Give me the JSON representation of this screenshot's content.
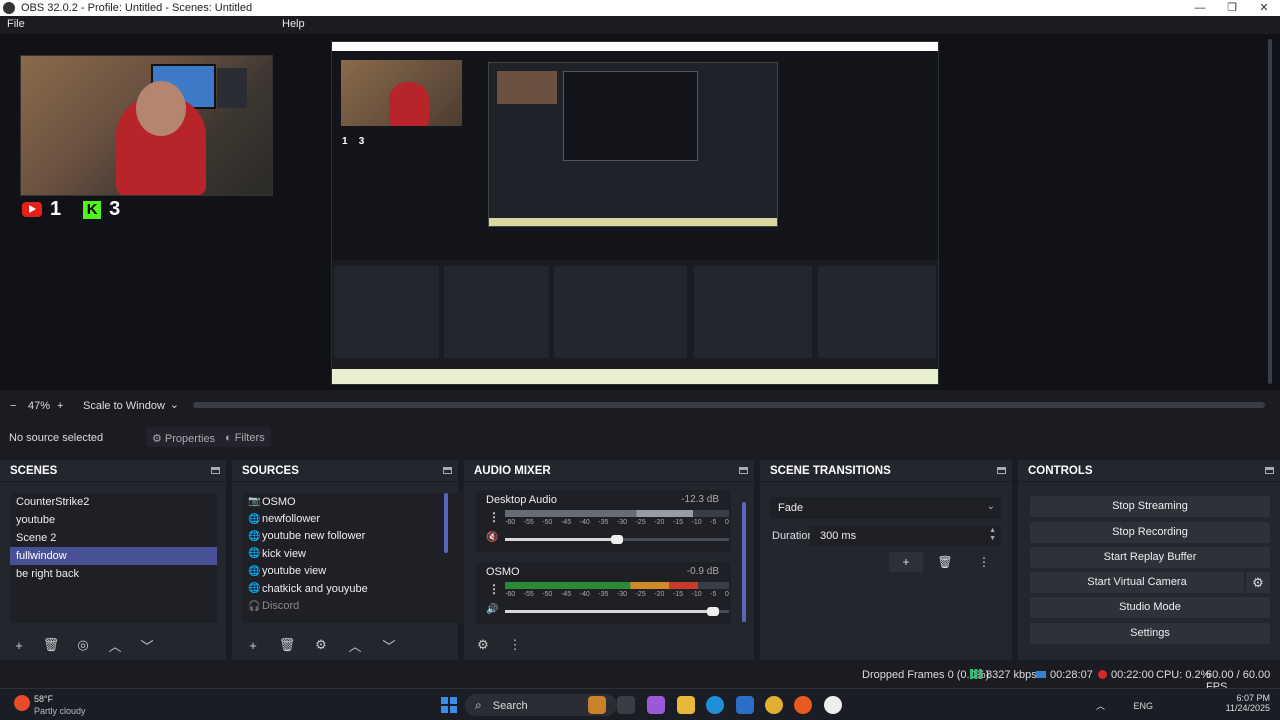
{
  "window": {
    "title": "OBS 32.0.2 - Profile: Untitled - Scenes: Untitled",
    "minimize": "—",
    "maximize": "❐",
    "close": "✕"
  },
  "menu": {
    "file": "File",
    "help": "Help"
  },
  "preview": {
    "yt_count": "1",
    "kick_count": "3",
    "kick_letter": "K"
  },
  "zoom": {
    "minus": "−",
    "level": "47%",
    "plus": "+",
    "scale_mode": "Scale to Window",
    "chevron": "⌄"
  },
  "source_bar": {
    "no_source": "No source selected",
    "properties": "Properties",
    "filters": "Filters"
  },
  "scenes": {
    "title": "SCENES",
    "items": [
      "CounterStrike2",
      "youtube",
      "Scene 2",
      "fullwindow",
      "be right back"
    ],
    "selected_index": 3
  },
  "sources": {
    "title": "SOURCES",
    "items": [
      {
        "name": "OSMO",
        "icon": "camera-icon",
        "visible": true
      },
      {
        "name": "newfollower",
        "icon": "globe-icon",
        "visible": true
      },
      {
        "name": "youtube new follower",
        "icon": "globe-icon",
        "visible": true
      },
      {
        "name": "kick view",
        "icon": "globe-icon",
        "visible": true
      },
      {
        "name": "youtube view",
        "icon": "globe-icon",
        "visible": true
      },
      {
        "name": "chatkick and youyube",
        "icon": "globe-icon",
        "visible": true
      },
      {
        "name": "Discord",
        "icon": "headphones-icon",
        "visible": false
      }
    ]
  },
  "mixer": {
    "title": "AUDIO MIXER",
    "channels": [
      {
        "name": "Desktop Audio",
        "db": "-12.3 dB",
        "muted": true,
        "level": 0.5
      },
      {
        "name": "OSMO",
        "db": "-0.9 dB",
        "muted": false,
        "level": 0.93
      }
    ],
    "ticks": [
      "-60",
      "-55",
      "-50",
      "-45",
      "-40",
      "-35",
      "-30",
      "-25",
      "-20",
      "-15",
      "-10",
      "-5",
      "0"
    ]
  },
  "transitions": {
    "title": "SCENE TRANSITIONS",
    "selected": "Fade",
    "duration_label": "Duration",
    "duration_value": "300 ms"
  },
  "controls": {
    "title": "CONTROLS",
    "stop_streaming": "Stop Streaming",
    "stop_recording": "Stop Recording",
    "start_replay": "Start Replay Buffer",
    "start_virtual": "Start Virtual Camera",
    "studio_mode": "Studio Mode",
    "settings": "Settings"
  },
  "status": {
    "dropped": "Dropped Frames 0 (0.0%)",
    "bitrate": "8327 kbps",
    "stream_time": "00:28:07",
    "record_time": "00:22:00",
    "cpu": "CPU: 0.2%",
    "fps": "60.00 / 60.00 FPS"
  },
  "taskbar": {
    "temp": "58°F",
    "condition": "Partly cloudy",
    "search": "Search",
    "lang": "ENG",
    "time": "6:07 PM",
    "date": "11/24/2025"
  },
  "colors": {
    "accent": "#485198",
    "live_red": "#d02a2a",
    "kick_green": "#52f21e",
    "yt_red": "#e62117"
  }
}
